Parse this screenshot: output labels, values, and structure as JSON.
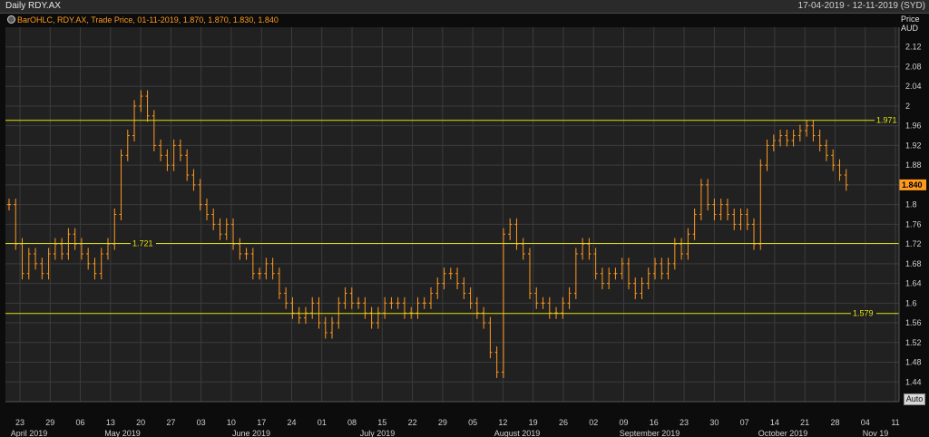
{
  "window": {
    "title": "Daily RDY.AX",
    "date_range": "17-04-2019 - 12-11-2019 (SYD)"
  },
  "legend": {
    "icon": "circle-icon",
    "text": "BarOHLC, RDY.AX, Trade Price, 01-11-2019, 1.870, 1.870, 1.830, 1.840"
  },
  "price_axis": {
    "title": "Price",
    "unit": "AUD"
  },
  "auto_button": "Auto",
  "colors": {
    "background": "#212121",
    "grid": "#3c3c3c",
    "bars": "#ff9a1f",
    "level_lines": "#e0e010",
    "last_price_bg": "#ff9a1f"
  },
  "chart_data": {
    "type": "bar",
    "subtype": "ohlc",
    "series_label": "BarOHLC",
    "y_unit": "AUD",
    "ylim": [
      1.4,
      2.16
    ],
    "yticks": [
      "2.12",
      "2.08",
      "2.04",
      "2",
      "1.96",
      "1.92",
      "1.88",
      "1.84",
      "1.8",
      "1.76",
      "1.72",
      "1.68",
      "1.64",
      "1.6",
      "1.56",
      "1.52",
      "1.48",
      "1.44"
    ],
    "x_day_ticks": [
      "23",
      "29",
      "06",
      "13",
      "20",
      "27",
      "03",
      "10",
      "17",
      "24",
      "01",
      "08",
      "15",
      "22",
      "29",
      "05",
      "12",
      "19",
      "26",
      "02",
      "09",
      "16",
      "23",
      "30",
      "07",
      "14",
      "21",
      "28",
      "04",
      "11"
    ],
    "x_month_labels": [
      "April 2019",
      "May 2019",
      "June 2019",
      "July 2019",
      "August 2019",
      "September 2019",
      "October 2019",
      "Nov 19"
    ],
    "horizontal_levels": [
      {
        "value": 1.971,
        "label": "1.971"
      },
      {
        "value": 1.721,
        "label": "1.721"
      },
      {
        "value": 1.579,
        "label": "1.579"
      }
    ],
    "last_price": "1.840",
    "closes": [
      1.8,
      1.72,
      1.66,
      1.7,
      1.68,
      1.66,
      1.7,
      1.72,
      1.7,
      1.74,
      1.72,
      1.7,
      1.68,
      1.66,
      1.7,
      1.72,
      1.78,
      1.9,
      1.94,
      2.0,
      2.02,
      1.98,
      1.92,
      1.9,
      1.88,
      1.92,
      1.9,
      1.86,
      1.84,
      1.8,
      1.78,
      1.76,
      1.74,
      1.76,
      1.72,
      1.7,
      1.7,
      1.66,
      1.66,
      1.68,
      1.66,
      1.62,
      1.6,
      1.58,
      1.57,
      1.58,
      1.6,
      1.56,
      1.54,
      1.56,
      1.6,
      1.62,
      1.6,
      1.6,
      1.58,
      1.56,
      1.58,
      1.6,
      1.6,
      1.6,
      1.58,
      1.58,
      1.6,
      1.6,
      1.62,
      1.64,
      1.66,
      1.66,
      1.64,
      1.62,
      1.6,
      1.58,
      1.56,
      1.5,
      1.46,
      1.74,
      1.76,
      1.72,
      1.7,
      1.62,
      1.6,
      1.6,
      1.58,
      1.58,
      1.6,
      1.62,
      1.7,
      1.72,
      1.7,
      1.66,
      1.64,
      1.66,
      1.66,
      1.68,
      1.64,
      1.62,
      1.64,
      1.66,
      1.68,
      1.66,
      1.68,
      1.72,
      1.7,
      1.74,
      1.78,
      1.84,
      1.8,
      1.78,
      1.8,
      1.78,
      1.76,
      1.78,
      1.76,
      1.72,
      1.88,
      1.92,
      1.93,
      1.94,
      1.93,
      1.94,
      1.95,
      1.96,
      1.94,
      1.92,
      1.9,
      1.88,
      1.86,
      1.84
    ]
  }
}
